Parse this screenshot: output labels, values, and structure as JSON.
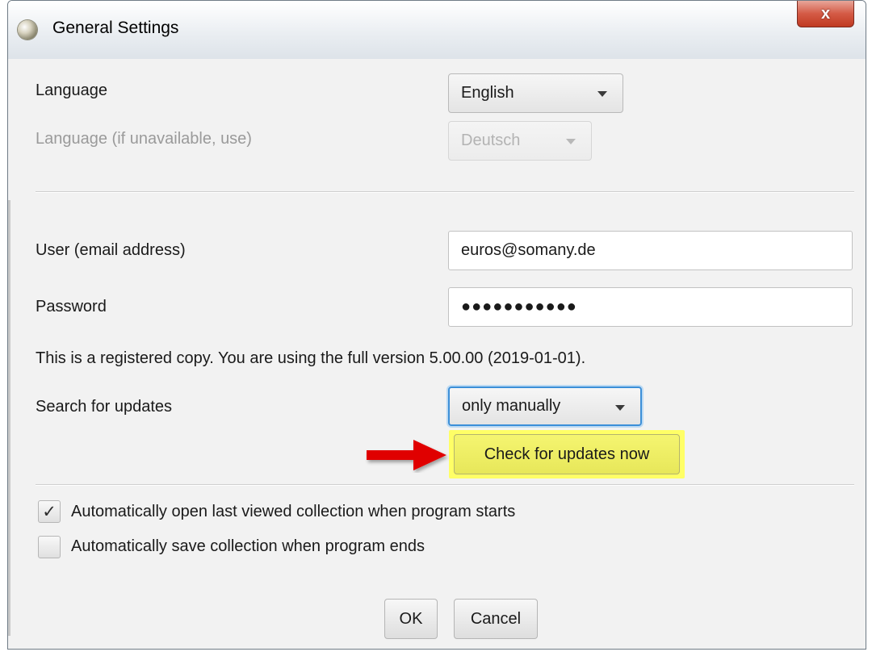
{
  "window": {
    "title": "General Settings",
    "close_label": "x"
  },
  "language": {
    "label": "Language",
    "value": "English",
    "fallback_label": "Language (if unavailable, use)",
    "fallback_value": "Deutsch"
  },
  "account": {
    "user_label": "User (email address)",
    "user_value": "euros@somany.de",
    "password_label": "Password",
    "password_mask": "●●●●●●●●●●●"
  },
  "registration_text": "This is a registered copy. You are using the full version 5.00.00 (2019-01-01).",
  "updates": {
    "label": "Search for updates",
    "value": "only manually",
    "check_now_label": "Check for updates now"
  },
  "options": [
    {
      "label": "Automatically open last viewed collection when program starts",
      "checked": true,
      "mark": "✓"
    },
    {
      "label": "Automatically save collection when program ends",
      "checked": false,
      "mark": ""
    }
  ],
  "buttons": {
    "ok": "OK",
    "cancel": "Cancel"
  },
  "colors": {
    "highlight": "#ffff66",
    "arrow": "#e00000",
    "focus_ring": "#3c8fd8",
    "close_button": "#c94a33"
  }
}
